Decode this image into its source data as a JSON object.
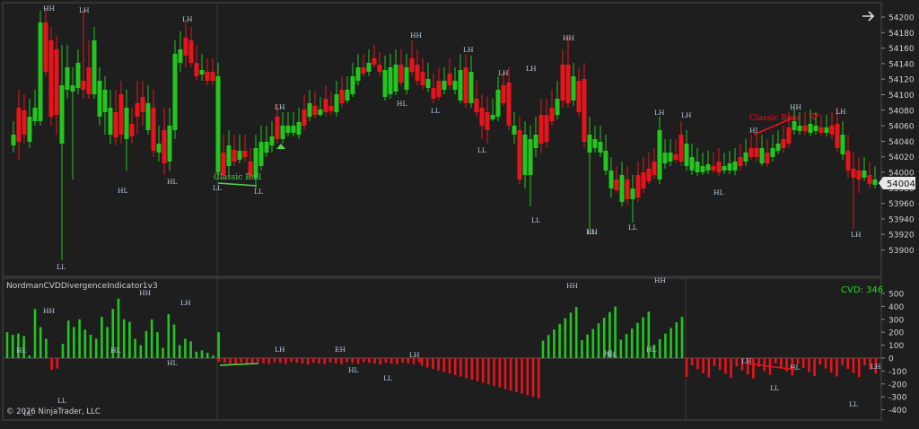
{
  "colors": {
    "background": "#1e1e1e",
    "frame": "#4a4a4a",
    "up": "#22c61e",
    "down": "#e8141c",
    "axis_text": "#d0d0d0",
    "label": "#b8cce0",
    "price_tag_bg": "#e8e8e8",
    "cvd_label": "#26d526",
    "classic_up": "#55d14a",
    "classic_down": "#e8141c"
  },
  "price_panel": {
    "y_ticks": [
      "54200",
      "54180",
      "54160",
      "54140",
      "54120",
      "54100",
      "54080",
      "54060",
      "54040",
      "54020",
      "54000",
      "53980",
      "53960",
      "53940",
      "53920",
      "53900"
    ],
    "current_price": "54004",
    "arrow_icon": "arrow-right-icon"
  },
  "indicator_panel": {
    "title": "NordmanCVDDivergenceIndicator1v3",
    "cvd_label": "CVD: 346",
    "y_ticks": [
      "500",
      "400",
      "300",
      "200",
      "100",
      "0",
      "-100",
      "-200",
      "-300",
      "-400"
    ]
  },
  "copyright": "© 2026 NinjaTrader, LLC",
  "annotations": {
    "classic_bull": "Classic Bull",
    "classic_bear": "Classic Bear"
  },
  "swing_labels": {
    "price": [
      "HH",
      "LH",
      "LH",
      "HL",
      "HL",
      "LL",
      "LL",
      "LL",
      "LH",
      "HH",
      "HL",
      "LL",
      "LH",
      "HH",
      "LH",
      "LL",
      "LH",
      "LL",
      "HH",
      "LL",
      "HL",
      "LH",
      "LH",
      "HL",
      "LH",
      "HH",
      "LH",
      "LL"
    ],
    "cvd": [
      "HL",
      "HH",
      "HH",
      "LL",
      "HL",
      "LH",
      "HL",
      "LL",
      "HL",
      "LH",
      "EH",
      "HL",
      "LL",
      "LH",
      "HH",
      "HH",
      "HL",
      "HL",
      "LH",
      "LL",
      "HL",
      "LH",
      "LL"
    ]
  }
}
